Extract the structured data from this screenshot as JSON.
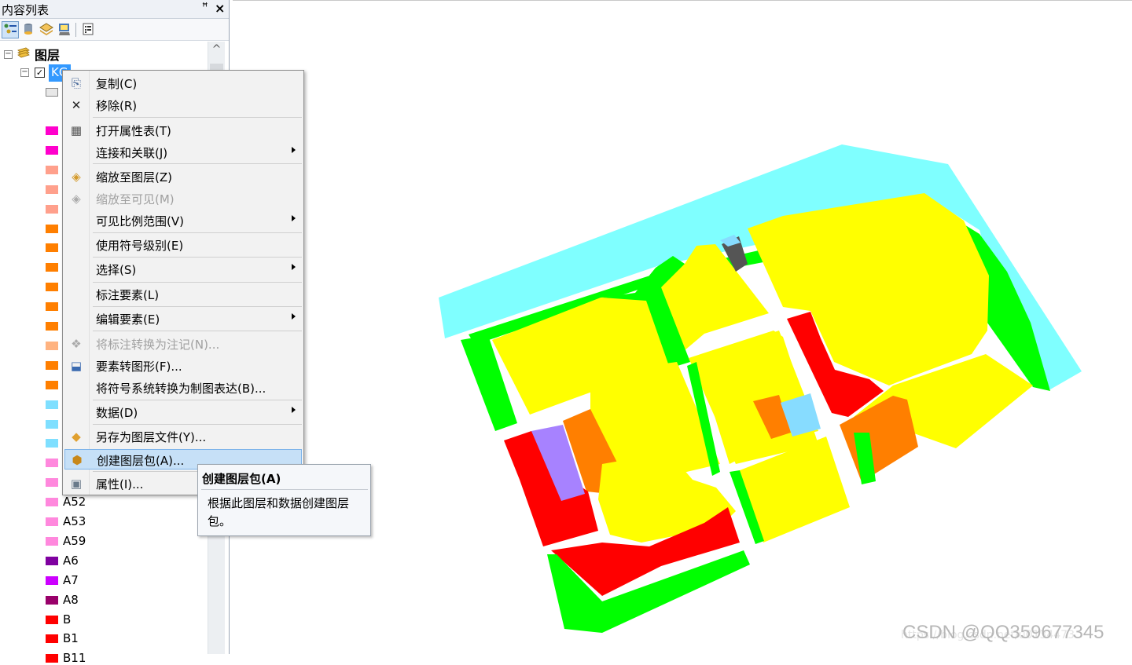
{
  "toc": {
    "title": "内容列表",
    "pin_icon": "pin-icon",
    "close_icon": "close-icon",
    "toolbar": [
      "list-by-drawing-order-icon",
      "list-by-source-icon",
      "list-by-visibility-icon",
      "list-by-selection-icon",
      "options-icon"
    ],
    "root_label": "图层",
    "layer_name": "KG",
    "layer_checked": true
  },
  "legend": [
    {
      "label": "",
      "color": "#ff00cc"
    },
    {
      "label": "",
      "color": "#ff00cc"
    },
    {
      "label": "",
      "color": "#ffa08c"
    },
    {
      "label": "",
      "color": "#ffa08c"
    },
    {
      "label": "",
      "color": "#ffa08c"
    },
    {
      "label": "",
      "color": "#ff7f00"
    },
    {
      "label": "",
      "color": "#ff7f00"
    },
    {
      "label": "",
      "color": "#ff7f00"
    },
    {
      "label": "",
      "color": "#ff7f00"
    },
    {
      "label": "",
      "color": "#ff7f00"
    },
    {
      "label": "",
      "color": "#ff7f00"
    },
    {
      "label": "",
      "color": "#ffb380"
    },
    {
      "label": "",
      "color": "#ff7f00"
    },
    {
      "label": "",
      "color": "#ff7f00"
    },
    {
      "label": "",
      "color": "#7fdfff"
    },
    {
      "label": "",
      "color": "#7fdfff"
    },
    {
      "label": "",
      "color": "#7fdfff"
    },
    {
      "label": "",
      "color": "#ff88dd"
    },
    {
      "label": "",
      "color": "#ff88dd"
    },
    {
      "label": "A52",
      "color": "#ff88dd"
    },
    {
      "label": "A53",
      "color": "#ff88dd"
    },
    {
      "label": "A59",
      "color": "#ff88dd"
    },
    {
      "label": "A6",
      "color": "#7f00a0"
    },
    {
      "label": "A7",
      "color": "#cc00ff"
    },
    {
      "label": "A8",
      "color": "#99006a"
    },
    {
      "label": "B",
      "color": "#ff0000"
    },
    {
      "label": "B1",
      "color": "#ff0000"
    },
    {
      "label": "B11",
      "color": "#ff0000"
    }
  ],
  "context_menu": {
    "items": [
      {
        "label": "复制(C)",
        "icon": "copy-icon",
        "enabled": true,
        "submenu": false
      },
      {
        "label": "移除(R)",
        "icon": "remove-icon",
        "enabled": true,
        "submenu": false
      },
      {
        "label": "打开属性表(T)",
        "icon": "attribute-table-icon",
        "enabled": true,
        "submenu": false
      },
      {
        "label": "连接和关联(J)",
        "icon": "",
        "enabled": true,
        "submenu": true
      },
      {
        "label": "缩放至图层(Z)",
        "icon": "zoom-to-layer-icon",
        "enabled": true,
        "submenu": false
      },
      {
        "label": "缩放至可见(M)",
        "icon": "zoom-to-visible-icon",
        "enabled": false,
        "submenu": false
      },
      {
        "label": "可见比例范围(V)",
        "icon": "",
        "enabled": true,
        "submenu": true
      },
      {
        "label": "使用符号级别(E)",
        "icon": "",
        "enabled": true,
        "submenu": false
      },
      {
        "label": "选择(S)",
        "icon": "",
        "enabled": true,
        "submenu": true
      },
      {
        "label": "标注要素(L)",
        "icon": "",
        "enabled": true,
        "submenu": false
      },
      {
        "label": "编辑要素(E)",
        "icon": "",
        "enabled": true,
        "submenu": true
      },
      {
        "label": "将标注转换为注记(N)...",
        "icon": "convert-labels-icon",
        "enabled": false,
        "submenu": false
      },
      {
        "label": "要素转图形(F)...",
        "icon": "features-to-graphics-icon",
        "enabled": true,
        "submenu": false
      },
      {
        "label": "将符号系统转换为制图表达(B)...",
        "icon": "",
        "enabled": true,
        "submenu": false
      },
      {
        "label": "数据(D)",
        "icon": "",
        "enabled": true,
        "submenu": true
      },
      {
        "label": "另存为图层文件(Y)...",
        "icon": "save-layer-file-icon",
        "enabled": true,
        "submenu": false
      },
      {
        "label": "创建图层包(A)...",
        "icon": "create-layer-package-icon",
        "enabled": true,
        "submenu": false,
        "highlighted": true
      },
      {
        "label": "属性(I)...",
        "icon": "properties-icon",
        "enabled": true,
        "submenu": false
      }
    ]
  },
  "tooltip": {
    "title": "创建图层包(A)",
    "description": "根据此图层和数据创建图层包。"
  },
  "map": {
    "colors": {
      "water": "#7fffff",
      "green": "#00ff00",
      "residential": "#ffff00",
      "commercial": "#ff0000",
      "orange": "#ff7f00",
      "purple": "#a782ff",
      "lightblue": "#87dcff",
      "gray": "#555555"
    },
    "watermark": "CSDN @QQ359677345"
  }
}
